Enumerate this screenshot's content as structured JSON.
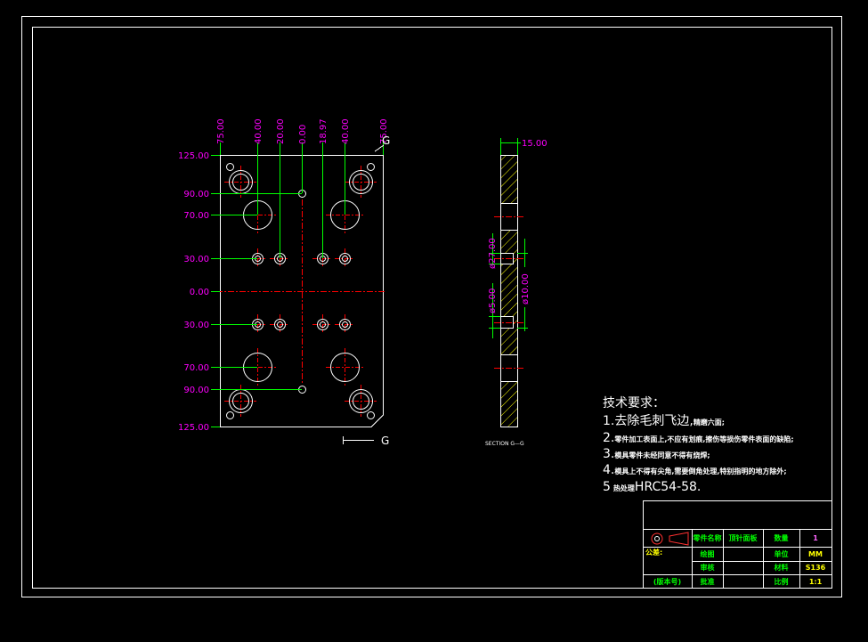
{
  "drawing": {
    "colors": {
      "background": "#000000",
      "outline": "#ffffff",
      "dimension_text": "#ff00ff",
      "dimension_line": "#00ff00",
      "centerline": "#ff0000",
      "hatch": "#ffff00"
    }
  },
  "plan_view": {
    "top_dims": [
      "75.00",
      "40.00",
      "20.00",
      "0.00",
      "18.97",
      "40.00",
      "75.00"
    ],
    "left_dims": [
      "125.00",
      "90.00",
      "70.00",
      "30.00",
      "0.00",
      "30.00",
      "70.00",
      "90.00",
      "125.00"
    ],
    "cut_label_top": "G",
    "cut_label_bottom": "G"
  },
  "section_view": {
    "thickness": "15.00",
    "dia_27": "ø27.00",
    "dia_10": "ø10.00",
    "dia_5": "ø5.00",
    "caption": "SECTION G—G"
  },
  "tech_requirements": {
    "title": "技术要求：",
    "items": [
      {
        "lead": "1.去除毛刺飞边,",
        "note": "精磨六面;"
      },
      {
        "lead": "2.",
        "note": "零件加工表面上,不应有划痕,擦伤等损伤零件表面的缺陷;"
      },
      {
        "lead": "3.",
        "note": "模具零件未经同意不得有烧焊;"
      },
      {
        "lead": "4.",
        "note": "模具上不得有尖角,需要倒角处理,特别指明的地方除外;"
      },
      {
        "lead": "5",
        "note": "热处理",
        "tail": "HRC54-58."
      }
    ]
  },
  "title_block": {
    "part_name_label": "零件名称",
    "part_name": "顶针面板",
    "quantity_label": "数量",
    "quantity": "1",
    "tolerance_label": "公差:",
    "drawn_label": "绘图",
    "unit_label": "单位",
    "unit": "MM",
    "checked_label": "审核",
    "material_label": "材料",
    "material": "S136",
    "version_label": "(版本号)",
    "approved_label": "批准",
    "scale_label": "比例",
    "scale": "1:1"
  }
}
